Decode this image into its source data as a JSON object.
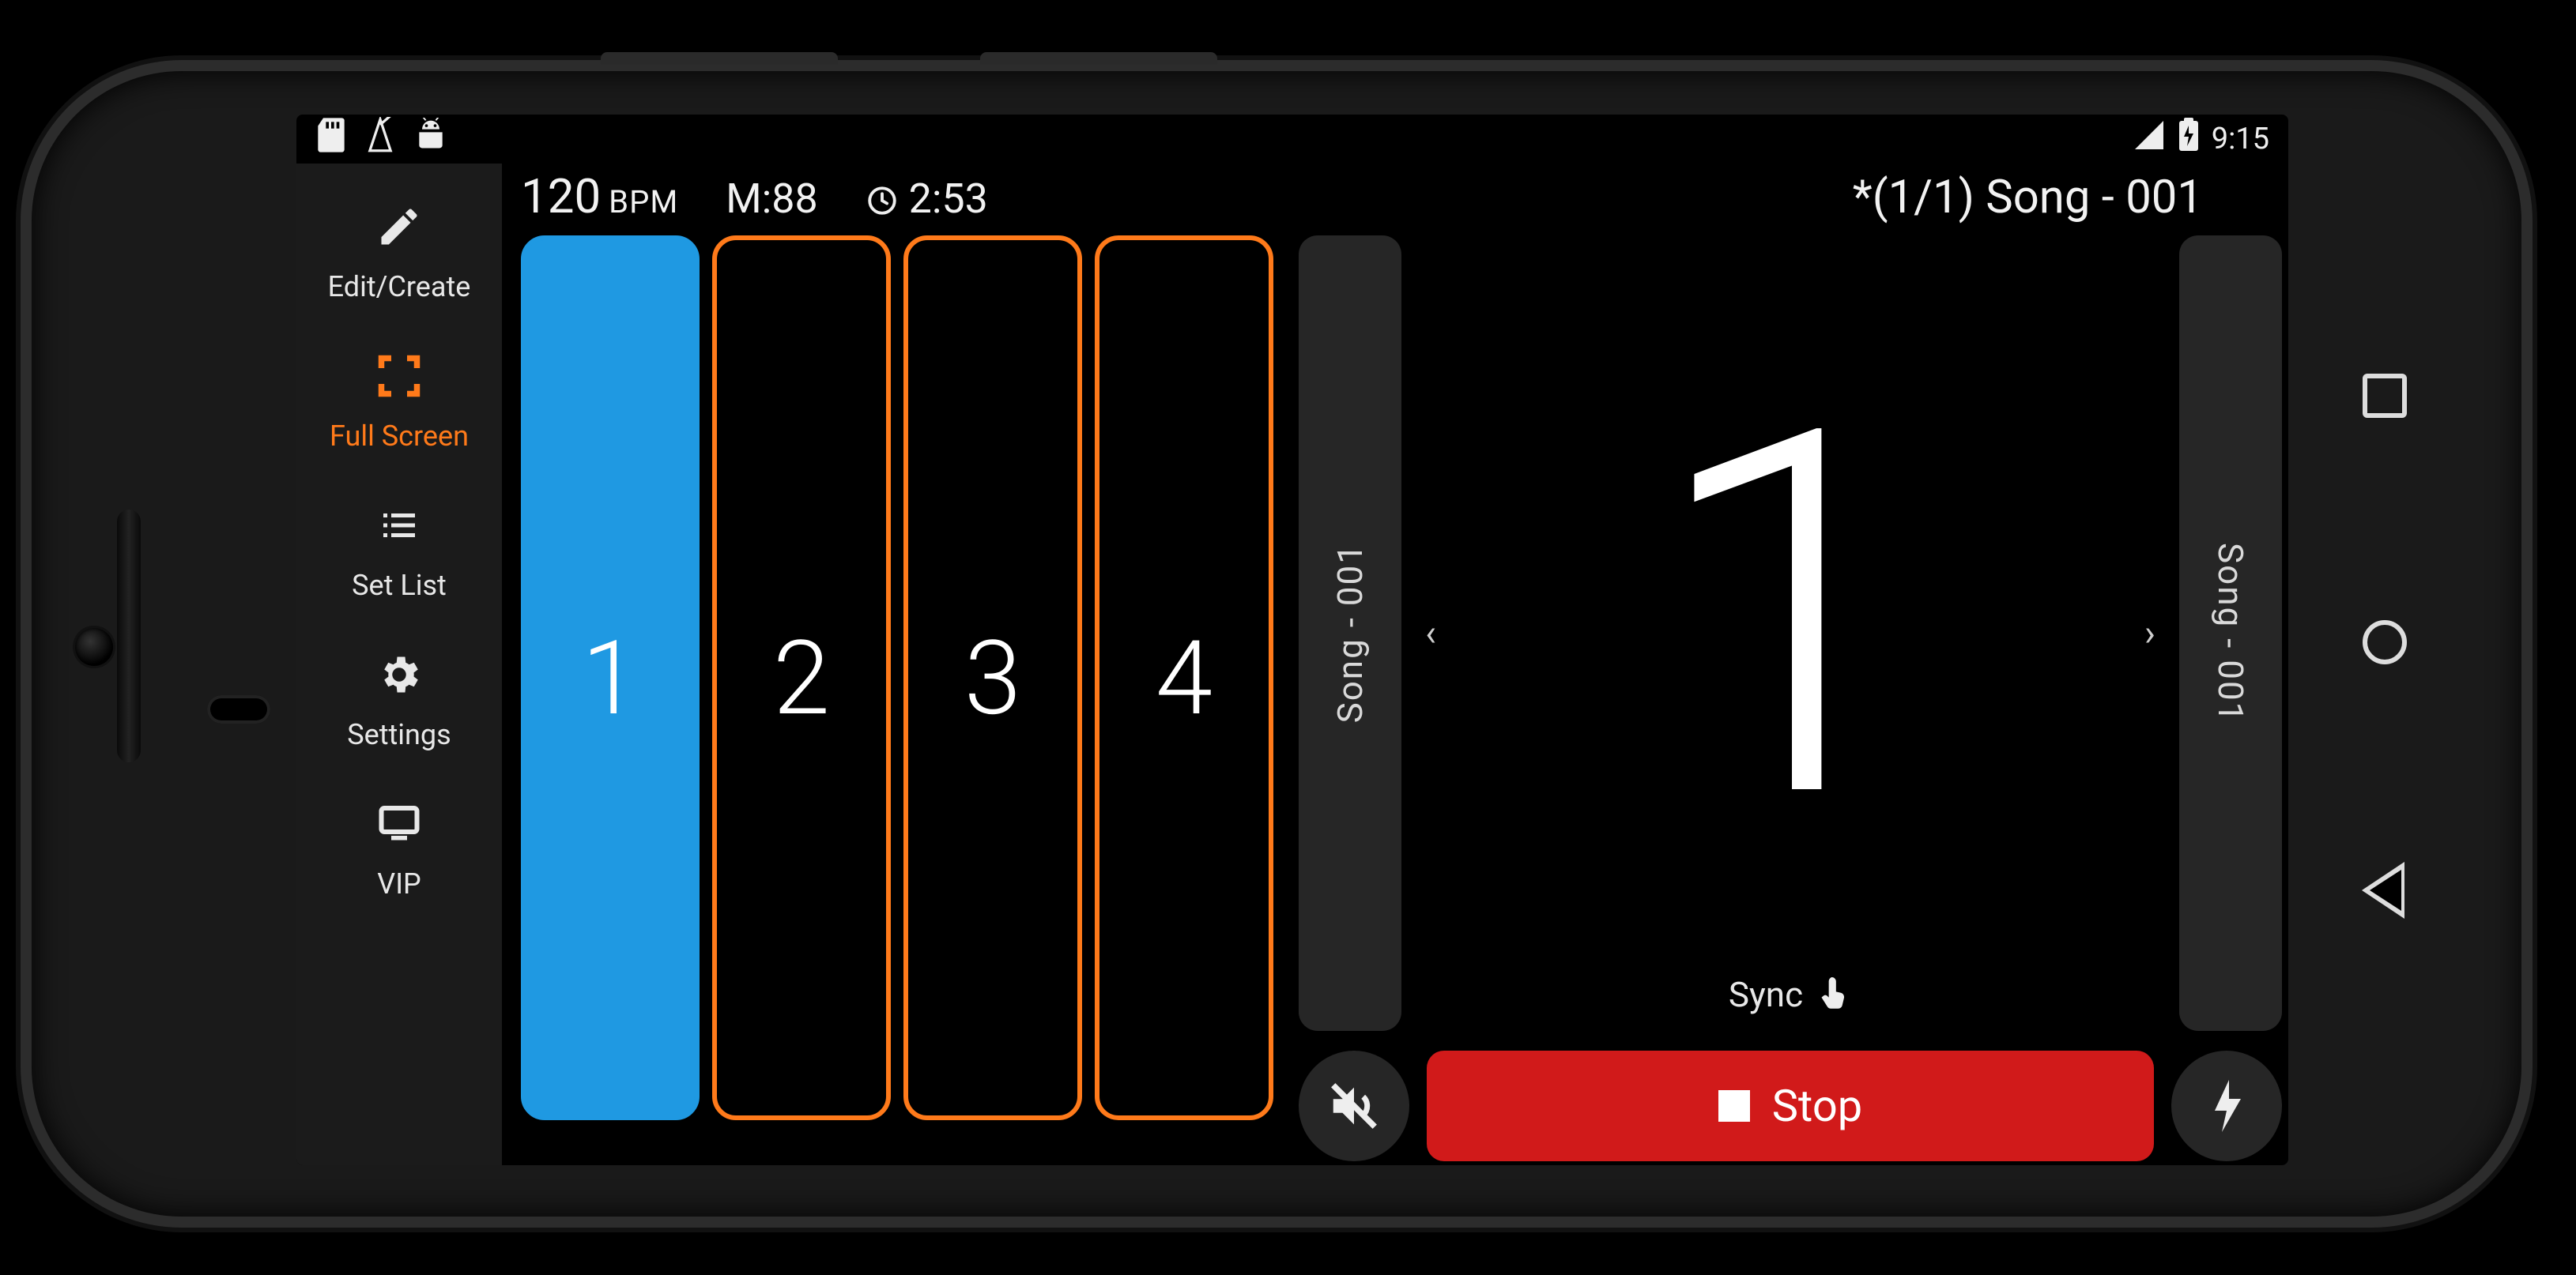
{
  "status": {
    "time": "9:15",
    "icons": [
      "sd-card",
      "metronome",
      "android-robot"
    ],
    "right_icons": [
      "cell-signal",
      "battery-charging"
    ]
  },
  "sidebar": {
    "items": [
      {
        "label": "Edit/Create",
        "icon": "pencil-icon",
        "active": false
      },
      {
        "label": "Full Screen",
        "icon": "fullscreen-icon",
        "active": true
      },
      {
        "label": "Set List",
        "icon": "list-icon",
        "active": false
      },
      {
        "label": "Settings",
        "icon": "gear-icon",
        "active": false
      },
      {
        "label": "VIP",
        "icon": "monitor-icon",
        "active": false
      }
    ]
  },
  "info": {
    "bpm_value": "120",
    "bpm_unit": "BPM",
    "measure": "M:88",
    "elapsed": "2:53",
    "song_title": "*(1/1) Song - 001"
  },
  "beats": {
    "count": 4,
    "labels": [
      "1",
      "2",
      "3",
      "4"
    ],
    "active_index": 0
  },
  "stage": {
    "prev_song": "Song - 001",
    "next_song": "Song - 001",
    "big_count": "1",
    "sync_label": "Sync"
  },
  "controls": {
    "mute_icon": "volume-mute-icon",
    "stop_label": "Stop",
    "flash_icon": "bolt-icon"
  },
  "colors": {
    "accent": "#ff7a1a",
    "beat_active": "#1f99e2",
    "stop": "#d11a1a"
  }
}
